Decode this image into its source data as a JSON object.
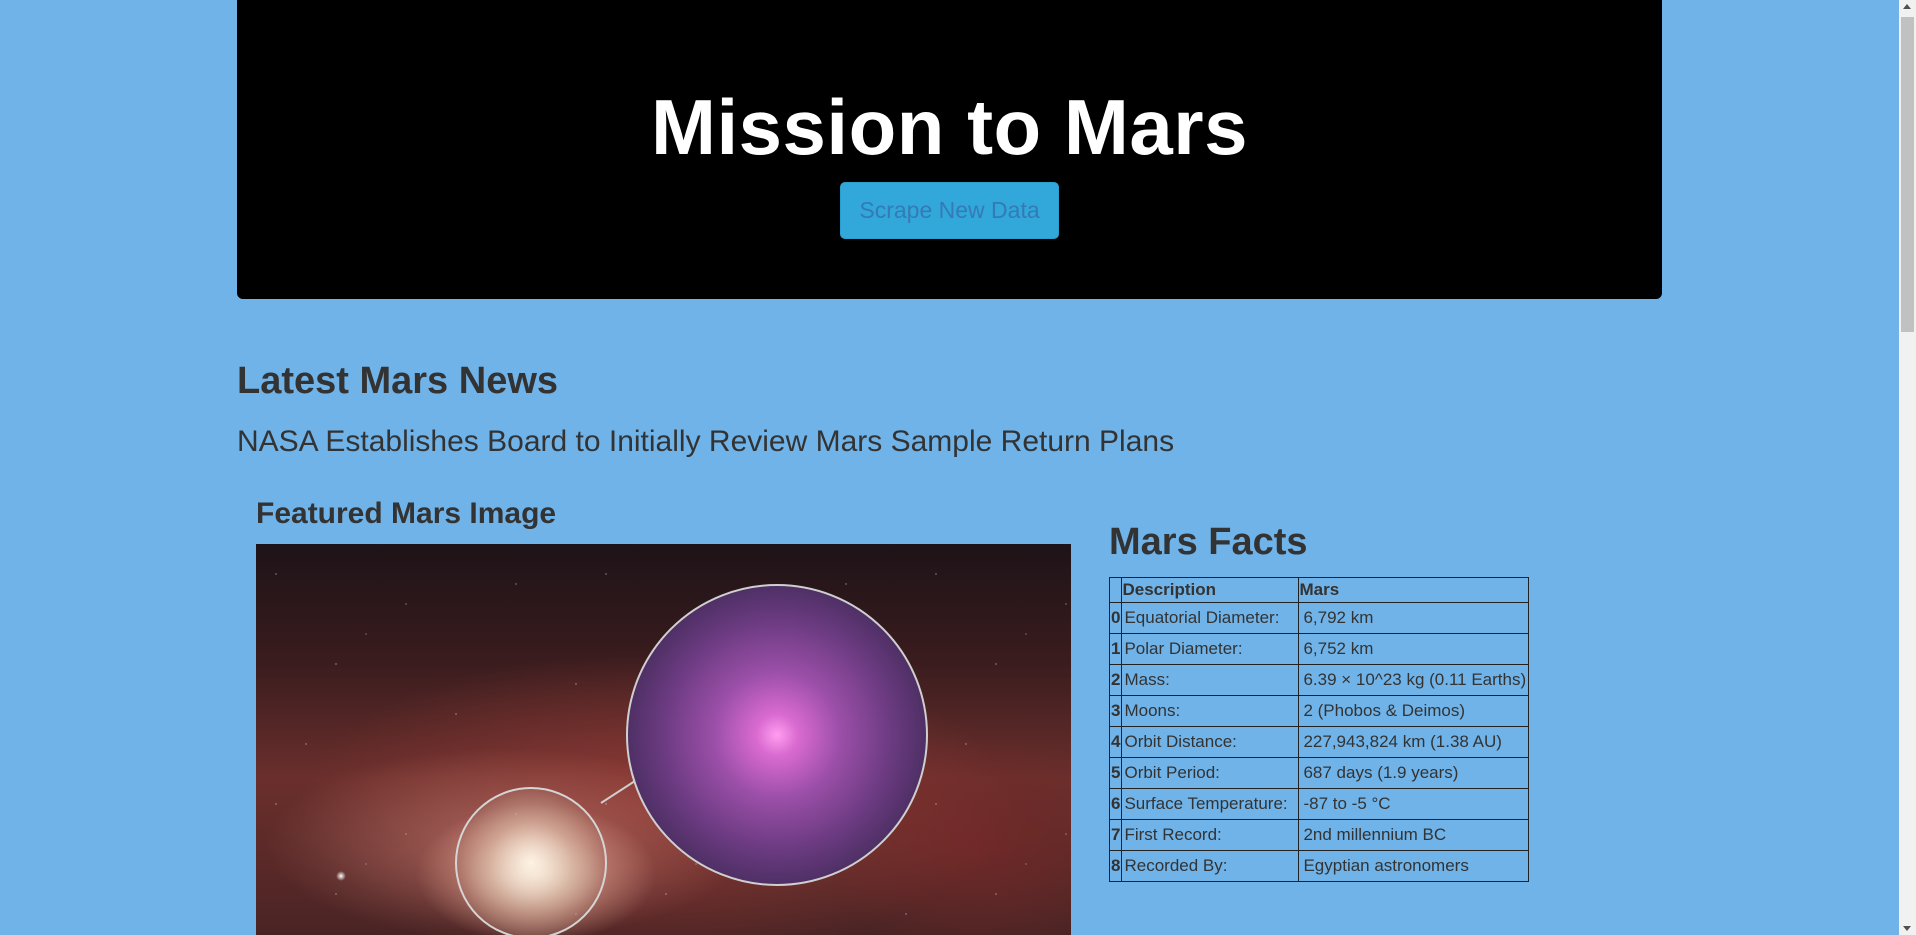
{
  "header": {
    "title": "Mission to Mars",
    "scrape_button_label": "Scrape New Data"
  },
  "news": {
    "heading": "Latest Mars News",
    "title": "NASA Establishes Board to Initially Review Mars Sample Return Plans"
  },
  "featured": {
    "heading": "Featured Mars Image"
  },
  "facts": {
    "heading": "Mars Facts",
    "columns": [
      "",
      "Description",
      "Mars"
    ],
    "rows": [
      {
        "idx": "0",
        "description": "Equatorial Diameter:",
        "value": "6,792 km"
      },
      {
        "idx": "1",
        "description": "Polar Diameter:",
        "value": "6,752 km"
      },
      {
        "idx": "2",
        "description": "Mass:",
        "value": "6.39 × 10^23 kg (0.11 Earths)"
      },
      {
        "idx": "3",
        "description": "Moons:",
        "value": "2 (Phobos & Deimos)"
      },
      {
        "idx": "4",
        "description": "Orbit Distance:",
        "value": "227,943,824 km (1.38 AU)"
      },
      {
        "idx": "5",
        "description": "Orbit Period:",
        "value": "687 days (1.9 years)"
      },
      {
        "idx": "6",
        "description": "Surface Temperature:",
        "value": "-87 to -5 °C"
      },
      {
        "idx": "7",
        "description": "First Record:",
        "value": "2nd millennium BC"
      },
      {
        "idx": "8",
        "description": "Recorded By:",
        "value": "Egyptian astronomers"
      }
    ]
  },
  "colors": {
    "page_background": "#6fb3e9",
    "jumbotron": "#000000",
    "button": "#31a8d9"
  }
}
